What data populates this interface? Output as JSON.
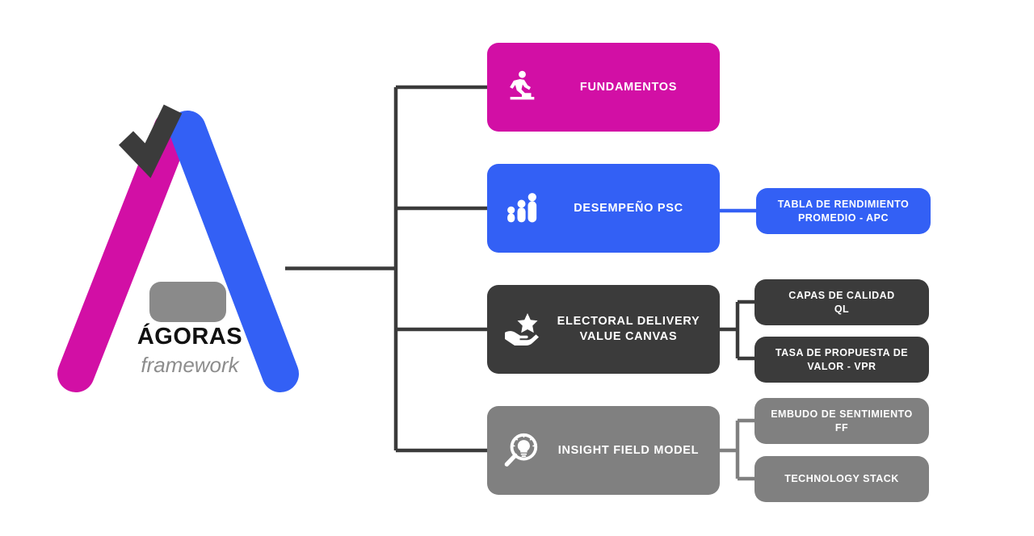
{
  "logo": {
    "name": "ÁGORAS",
    "tagline": "framework",
    "colors": {
      "magenta": "#D20FA5",
      "blue": "#3360F5",
      "dark": "#3B3B3B",
      "gray": "#8A8A8A"
    }
  },
  "palette": {
    "magenta": "#D20FA5",
    "blue": "#3360F5",
    "dark_gray": "#3B3B3B",
    "mid_gray": "#808080",
    "connector_dark": "#3B3B3B",
    "connector_blue": "#3360F5",
    "connector_gray": "#808080",
    "text_on_node": "#FFFFFF"
  },
  "diagram": {
    "type": "tree",
    "root": "ÁGORAS framework",
    "branches": [
      {
        "id": "fundamentos",
        "label": "FUNDAMENTOS",
        "icon": "walking-person-steps-icon",
        "color": "#D20FA5",
        "children": []
      },
      {
        "id": "desempeno-psc",
        "label": "DESEMPEÑO PSC",
        "icon": "bar-people-chart-icon",
        "color": "#3360F5",
        "children": [
          {
            "id": "tabla-rendimiento",
            "label": "TABLA DE  RENDIMIENTO\nPROMEDIO  - APC",
            "color": "#3360F5"
          }
        ]
      },
      {
        "id": "electoral-delivery-value-canvas",
        "label": "ELECTORAL DELIVERY\nVALUE  CANVAS",
        "icon": "hand-holding-star-icon",
        "color": "#3B3B3B",
        "children": [
          {
            "id": "capas-de-calidad",
            "label": "CAPAS DE CALIDAD\nQL",
            "color": "#3B3B3B"
          },
          {
            "id": "tasa-de-propuesta-de-valor",
            "label": "TASA DE PROPUESTA DE\nVALOR - VPR",
            "color": "#3B3B3B"
          }
        ]
      },
      {
        "id": "insight-field-model",
        "label": "INSIGHT FIELD MODEL",
        "icon": "magnifier-lightbulb-icon",
        "color": "#808080",
        "children": [
          {
            "id": "embudo-de-sentimiento",
            "label": "EMBUDO DE SENTIMIENTO\nFF",
            "color": "#808080"
          },
          {
            "id": "technology-stack",
            "label": "TECHNOLOGY STACK",
            "color": "#808080"
          }
        ]
      }
    ]
  }
}
